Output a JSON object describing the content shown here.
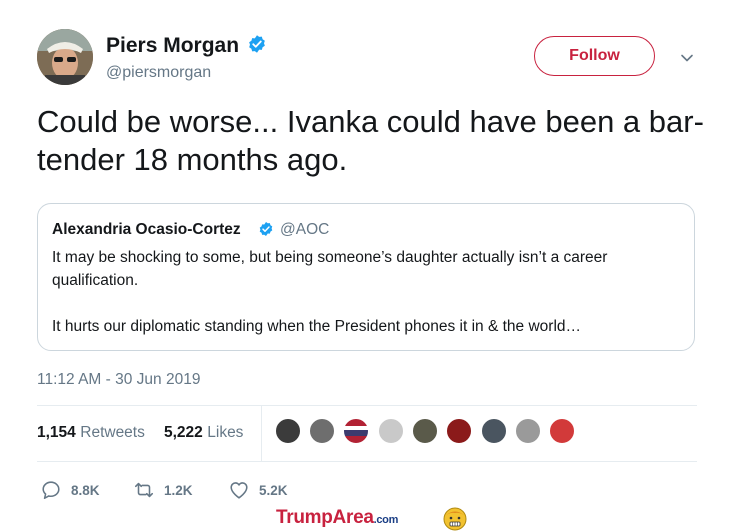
{
  "tweet": {
    "author_name": "Piers Morgan",
    "author_handle": "@piersmorgan",
    "follow_label": "Follow",
    "text": "Could be worse... Ivanka could have been a bar-tender 18 months ago.",
    "timestamp": "11:12 AM - 30 Jun 2019"
  },
  "quoted": {
    "author_name": "Alexandria Ocasio-Cortez",
    "author_handle": "@AOC",
    "text_line1": "It may be shocking to some, but being someone’s daughter actually isn’t a career qualification.",
    "text_line2": "It hurts our diplomatic standing when the President phones it in & the world…"
  },
  "stats": {
    "retweets_count": "1,154",
    "retweets_label": "Retweets",
    "likes_count": "5,222",
    "likes_label": "Likes",
    "liker_avatars": 9
  },
  "actions": {
    "reply_count": "8.8K",
    "retweet_count": "1.2K",
    "like_count": "5.2K"
  },
  "watermark": {
    "brand_main": "TrumpArea",
    "brand_suffix": ".com"
  },
  "colors": {
    "accent": "#c8223f",
    "verified": "#1da1f2",
    "muted": "#657786",
    "border": "#ccd6dd"
  },
  "icons": {
    "verified": "verified-badge-icon",
    "chevron": "chevron-down-icon",
    "reply": "reply-icon",
    "retweet": "retweet-icon",
    "like": "heart-icon"
  }
}
